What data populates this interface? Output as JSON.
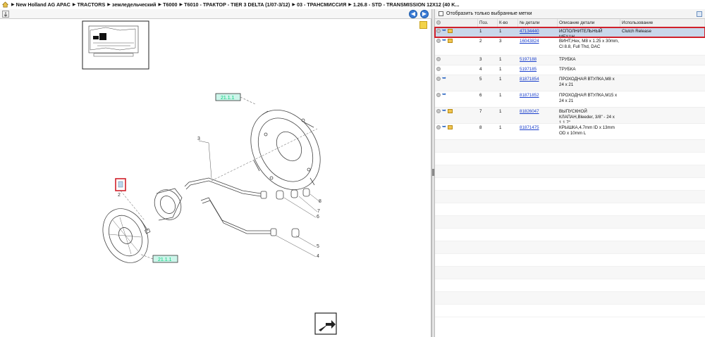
{
  "breadcrumb": {
    "home_icon": "home-icon",
    "items": [
      "New Holland AG APAC",
      "TRACTORS",
      "земледельческий",
      "T6000",
      "T6010 - ТРАКТОР - TIER 3 DELTA (1/07-3/12)",
      "03 - ТРАНСМИССИЯ",
      "1.26.8 - STD - TRANSMISSION 12X12 (40 K..."
    ]
  },
  "left_toolbar": {
    "icons": [
      "collapse-icon",
      "prev-icon",
      "next-icon",
      "note-icon"
    ]
  },
  "diagram": {
    "callouts": [
      "2",
      "3",
      "4",
      "5",
      "6",
      "7",
      "8"
    ],
    "refs": [
      "21.1.1",
      "21.1.1"
    ]
  },
  "filter": {
    "checkbox_label": "Отобразить только выбранные метки",
    "checked": false
  },
  "table": {
    "headers": [
      "",
      "Поз.",
      "К-во",
      "№ детали",
      "Описание детали",
      "Использование"
    ],
    "rows": [
      {
        "pos": "1",
        "qty": "1",
        "part": "47134440",
        "desc": "ИСПОЛНИТЕЛЬНЫЙ МЕХАН",
        "usage": "Clutch Release",
        "has_box": true,
        "selected": true
      },
      {
        "pos": "2",
        "qty": "3",
        "part": "16043824",
        "desc": "ВИНТ,Hex, M8 x 1.25 x 30mm, Cl 8.8, Full Thd, DAC",
        "usage": "",
        "has_box": true,
        "selected": false
      },
      {
        "pos": "3",
        "qty": "1",
        "part": "5197188",
        "desc": "ТРУБКА",
        "usage": "",
        "has_box": false,
        "selected": false
      },
      {
        "pos": "4",
        "qty": "1",
        "part": "5197185",
        "desc": "ТРУБКА",
        "usage": "",
        "has_box": false,
        "selected": false
      },
      {
        "pos": "5",
        "qty": "1",
        "part": "81871854",
        "desc": "ПРОХОДНАЯ ВТУЛКА,M8 x 24 x 21",
        "usage": "",
        "has_box": false,
        "selected": false
      },
      {
        "pos": "6",
        "qty": "1",
        "part": "81871852",
        "desc": "ПРОХОДНАЯ ВТУЛКА,M15 x 24 x 21",
        "usage": "",
        "has_box": false,
        "selected": false
      },
      {
        "pos": "7",
        "qty": "1",
        "part": "81826047",
        "desc": "ВЫПУСКНОЙ КЛАПАН,Bleeder, 3/8\" - 24 x 1.1.7\"",
        "usage": "",
        "has_box": true,
        "selected": false
      },
      {
        "pos": "8",
        "qty": "1",
        "part": "81871475",
        "desc": "КРЫШКА,4.7mm ID x 13mm OD x 10mm L",
        "usage": "",
        "has_box": true,
        "selected": false
      }
    ]
  }
}
